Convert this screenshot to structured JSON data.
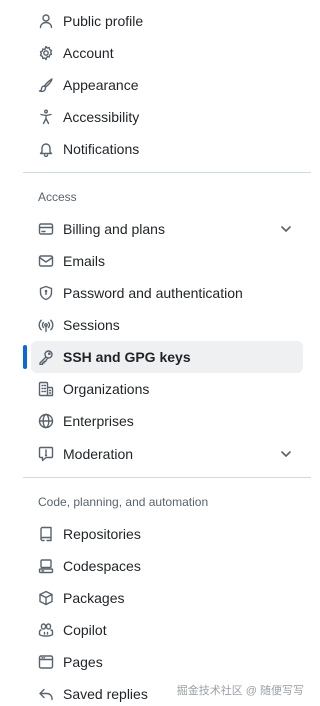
{
  "settings_nav": {
    "personal_items": [
      {
        "label": "Public profile",
        "icon": "person-icon"
      },
      {
        "label": "Account",
        "icon": "gear-icon"
      },
      {
        "label": "Appearance",
        "icon": "paintbrush-icon"
      },
      {
        "label": "Accessibility",
        "icon": "accessibility-icon"
      },
      {
        "label": "Notifications",
        "icon": "bell-icon"
      }
    ],
    "access_heading": "Access",
    "access_items": [
      {
        "label": "Billing and plans",
        "icon": "credit-card-icon",
        "expandable": true
      },
      {
        "label": "Emails",
        "icon": "mail-icon"
      },
      {
        "label": "Password and authentication",
        "icon": "shield-lock-icon"
      },
      {
        "label": "Sessions",
        "icon": "broadcast-icon"
      },
      {
        "label": "SSH and GPG keys",
        "icon": "key-icon",
        "active": true
      },
      {
        "label": "Organizations",
        "icon": "organization-icon"
      },
      {
        "label": "Enterprises",
        "icon": "globe-icon"
      },
      {
        "label": "Moderation",
        "icon": "report-icon",
        "expandable": true
      }
    ],
    "code_heading": "Code, planning, and automation",
    "code_items": [
      {
        "label": "Repositories",
        "icon": "repo-icon"
      },
      {
        "label": "Codespaces",
        "icon": "codespaces-icon"
      },
      {
        "label": "Packages",
        "icon": "package-icon"
      },
      {
        "label": "Copilot",
        "icon": "copilot-icon"
      },
      {
        "label": "Pages",
        "icon": "browser-icon"
      },
      {
        "label": "Saved replies",
        "icon": "reply-icon"
      }
    ]
  },
  "watermark": "掘金技术社区 @ 随便写写",
  "colors": {
    "active_indicator": "#0969da",
    "active_background": "#eef0f2"
  }
}
